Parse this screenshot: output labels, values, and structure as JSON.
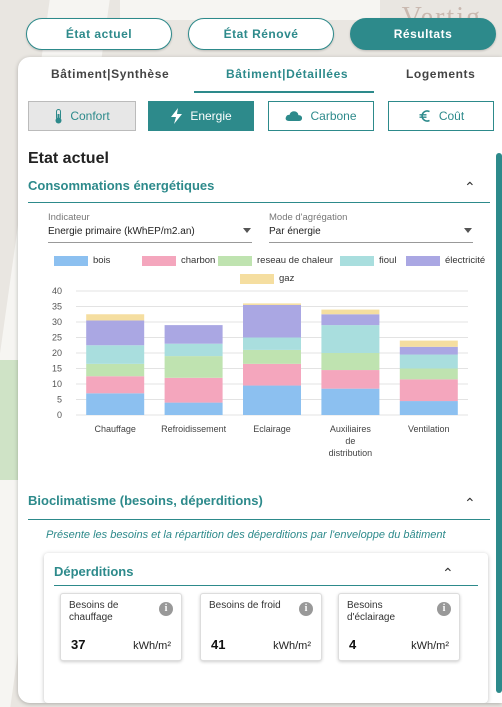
{
  "header": {
    "tabs": [
      {
        "label": "État actuel"
      },
      {
        "label": "État Rénové"
      },
      {
        "label": "Résultats"
      }
    ],
    "watermark": "Vertig"
  },
  "subtabs": [
    {
      "label": "Bâtiment|Synthèse"
    },
    {
      "label": "Bâtiment|Détaillées"
    },
    {
      "label": "Logements"
    }
  ],
  "categories": [
    {
      "label": "Confort",
      "icon": "thermometer-icon"
    },
    {
      "label": "Energie",
      "icon": "lightning-icon"
    },
    {
      "label": "Carbone",
      "icon": "cloud-icon"
    },
    {
      "label": "Coût",
      "icon": "euro-icon"
    }
  ],
  "page": {
    "title": "Etat actuel",
    "section1": "Consommations énergétiques",
    "section2": "Bioclimatisme (besoins, déperditions)",
    "section2_desc": "Présente les besoins et la répartition des déperditions par l'enveloppe du bâtiment",
    "subsection": "Déperditions"
  },
  "filters": {
    "indicator": {
      "label": "Indicateur",
      "value": "Energie primaire (kWhEP/m2.an)"
    },
    "aggregation": {
      "label": "Mode d'agrégation",
      "value": "Par énergie"
    }
  },
  "chart_data": {
    "type": "bar",
    "stacked": true,
    "categories": [
      [
        "Chauffage"
      ],
      [
        "Refroidissement"
      ],
      [
        "Eclairage"
      ],
      [
        "Auxiliaires",
        "de",
        "distribution"
      ],
      [
        "Ventilation"
      ]
    ],
    "ylim": [
      0,
      40
    ],
    "yticks": [
      0,
      5,
      10,
      15,
      20,
      25,
      30,
      35,
      40
    ],
    "grid": true,
    "legend_position": "top",
    "series": [
      {
        "name": "bois",
        "color": "#8cc0f0",
        "values": [
          7,
          4,
          9.5,
          8.5,
          4.5
        ]
      },
      {
        "name": "charbon",
        "color": "#f4a6bd",
        "values": [
          5.5,
          8,
          7,
          6,
          7
        ]
      },
      {
        "name": "reseau de chaleur",
        "color": "#bfe3b0",
        "values": [
          4,
          7,
          4.5,
          5.5,
          3.5
        ]
      },
      {
        "name": "fioul",
        "color": "#a9dede",
        "values": [
          6,
          4,
          4,
          9,
          4.5
        ]
      },
      {
        "name": "électricité",
        "color": "#aaa7e3",
        "values": [
          8,
          6,
          10.5,
          3.5,
          2.5
        ]
      },
      {
        "name": "gaz",
        "color": "#f5dea0",
        "values": [
          2,
          0,
          0.5,
          1.5,
          2
        ]
      }
    ]
  },
  "metrics": [
    {
      "label": "Besoins de chauffage",
      "value": "37",
      "unit": "kWh/m²"
    },
    {
      "label": "Besoins de froid",
      "value": "41",
      "unit": "kWh/m²"
    },
    {
      "label": "Besoins d'éclairage",
      "value": "4",
      "unit": "kWh/m²"
    }
  ],
  "info_glyph": "i",
  "chevron_glyph": "⌃"
}
